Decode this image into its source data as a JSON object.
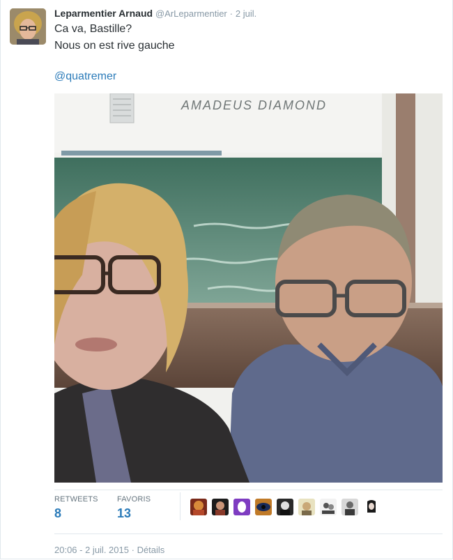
{
  "tweet": {
    "fullname": "Leparmentier Arnaud",
    "username": "@ArLeparmentier",
    "separator": "·",
    "date": "2 juil.",
    "lines": [
      "Ca va, Bastille?",
      "Nous on est rive gauche"
    ],
    "mention": "@quatremer",
    "photo_caption": "AMADEUS DIAMOND"
  },
  "stats": {
    "retweets_label": "RETWEETS",
    "retweets_value": "8",
    "favorites_label": "FAVORIS",
    "favorites_value": "13",
    "favoriter_avatar_count": 9
  },
  "meta": {
    "timestamp": "20:06 - 2 juil. 2015",
    "separator": "·",
    "details_label": "Détails"
  },
  "colors": {
    "link": "#2b7bb9",
    "text": "#292f33",
    "muted": "#8899a6",
    "border": "#e1e8ed"
  }
}
